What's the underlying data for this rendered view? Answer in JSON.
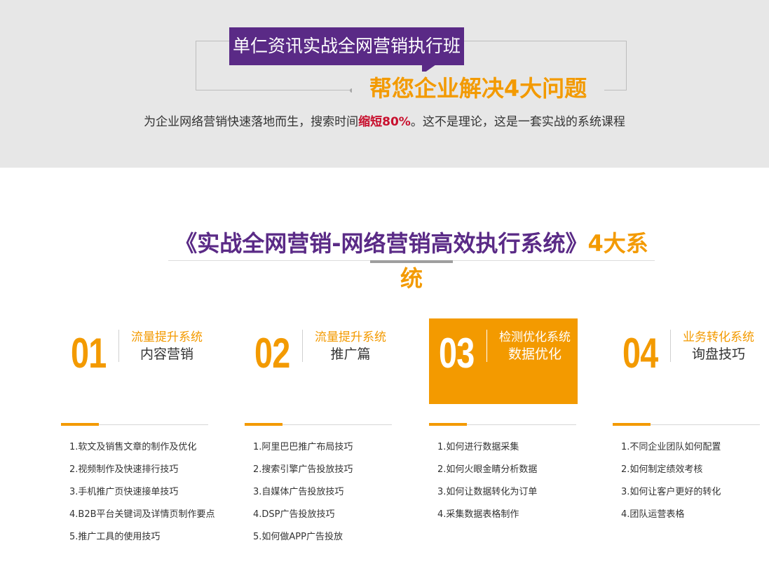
{
  "header": {
    "badge": "单仁资讯实战全网营销执行班",
    "headline": "帮您企业解决4大问题",
    "sub_prefix": "为企业网络营销快速落地而生，搜索时间",
    "sub_highlight": "缩短80%",
    "sub_suffix": "。这不是理论，这是一套实战的系统课程"
  },
  "section": {
    "title_purple": "《实战全网营销-网络营销高效执行系统》",
    "title_orange": "4大系统"
  },
  "colors": {
    "accent": "#f39a00",
    "purple": "#5a2a86",
    "highlight": "#c8102e"
  },
  "systems": [
    {
      "num": "01",
      "category": "流量提升系统",
      "name": "内容营销",
      "items": [
        "1.软文及销售文章的制作及优化",
        "2.视频制作及快速排行技巧",
        "3.手机推广页快速接单技巧",
        "4.B2B平台关键词及详情页制作要点",
        "5.推广工具的使用技巧"
      ]
    },
    {
      "num": "02",
      "category": "流量提升系统",
      "name": "推广篇",
      "items": [
        "1.阿里巴巴推广布局技巧",
        "2.搜索引擎广告投放技巧",
        "3.自媒体广告投放技巧",
        "4.DSP广告投放技巧",
        "5.如何做APP广告投放"
      ]
    },
    {
      "num": "03",
      "category": "检测优化系统",
      "name": "数据优化",
      "items": [
        "1.如何进行数据采集",
        "2.如何火眼金睛分析数据",
        "3.如何让数据转化为订单",
        "4.采集数据表格制作"
      ]
    },
    {
      "num": "04",
      "category": "业务转化系统",
      "name": "询盘技巧",
      "items": [
        "1.不同企业团队如何配置",
        "2.如何制定绩效考核",
        "3.如何让客户更好的转化",
        "4.团队运营表格"
      ]
    }
  ]
}
